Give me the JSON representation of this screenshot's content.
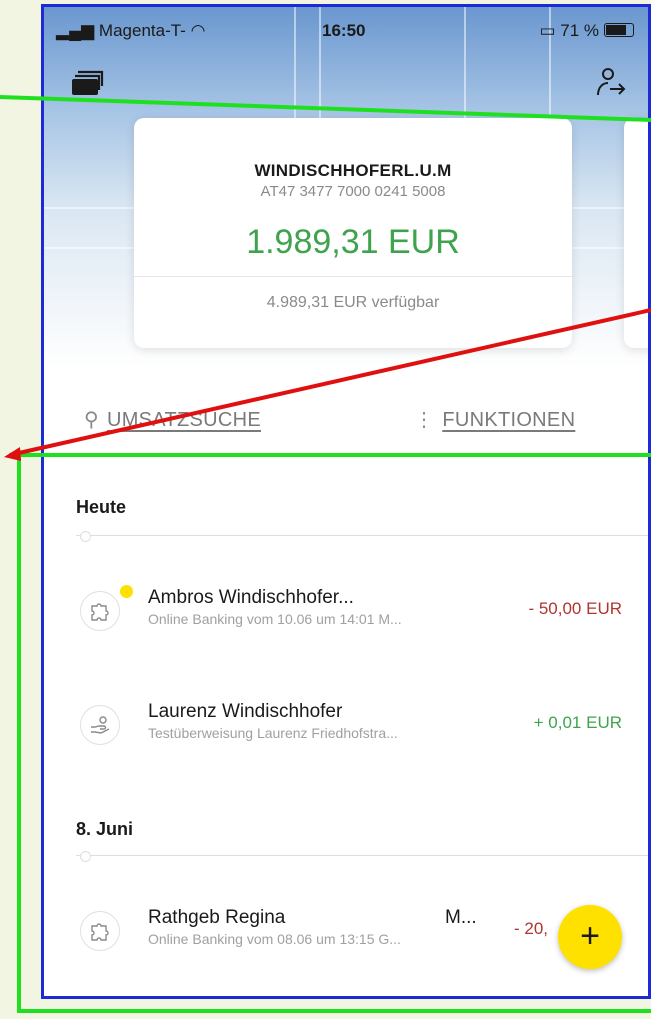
{
  "status_bar": {
    "carrier": "Magenta-T-",
    "time": "16:50",
    "battery": "71 %"
  },
  "account": {
    "name": "WINDISCHHOFERL.U.M",
    "iban": "AT47 3477 7000 0241 5008",
    "balance": "1.989,31 EUR",
    "available": "4.989,31 EUR verfügbar"
  },
  "actions": {
    "search_label": "UMSATZSUCHE",
    "functions_label": "FUNKTIONEN"
  },
  "sections": [
    {
      "label": "Heute",
      "transactions": [
        {
          "title": "Ambros Windischhofer...",
          "subtitle": "Online Banking vom 10.06 um 14:01 M...",
          "amount": "- 50,00 EUR",
          "type": "debit",
          "icon": "puzzle-icon",
          "unread": true
        },
        {
          "title": "Laurenz Windischhofer",
          "subtitle": "Testüberweisung Laurenz Friedhofstra...",
          "amount": "+ 0,01 EUR",
          "type": "credit",
          "icon": "hand-coin-icon",
          "unread": false
        }
      ]
    },
    {
      "label": "8. Juni",
      "transactions": [
        {
          "title": "Rathgeb Regina",
          "title_suffix": "M...",
          "subtitle": "Online Banking vom 08.06 um 13:15 G...",
          "amount": "- 20,",
          "type": "debit",
          "icon": "puzzle-icon",
          "unread": false
        }
      ]
    }
  ],
  "fab": {
    "label": "+"
  },
  "colors": {
    "positive": "#3fa34d",
    "negative": "#b0352f",
    "accent": "#ffe100",
    "frame": "#1d2ad6",
    "annotation_green": "#1fe01f",
    "annotation_red": "#e01010"
  }
}
